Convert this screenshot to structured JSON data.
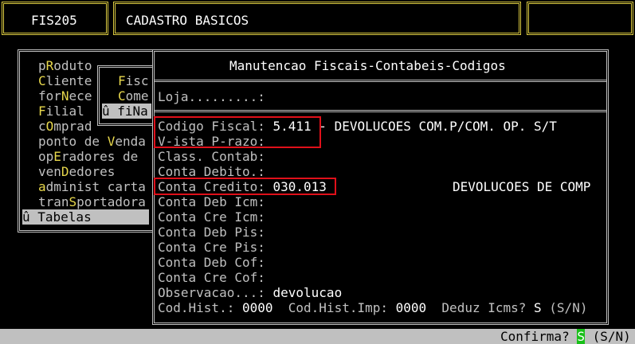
{
  "header": {
    "program_code": "FIS205",
    "module_title": "CADASTRO BASICOS"
  },
  "menu": {
    "items": [
      {
        "pre": "p",
        "hot": "R",
        "post": "oduto"
      },
      {
        "pre": "",
        "hot": "C",
        "post": "liente"
      },
      {
        "pre": "for",
        "hot": "N",
        "post": "ece"
      },
      {
        "pre": "",
        "hot": "F",
        "post": "ilial"
      },
      {
        "pre": "c",
        "hot": "O",
        "post": "mprad"
      },
      {
        "pre": "ponto de ",
        "hot": "V",
        "post": "enda"
      },
      {
        "pre": "op",
        "hot": "E",
        "post": "radores de"
      },
      {
        "pre": "ven",
        "hot": "D",
        "post": "edores"
      },
      {
        "pre": "",
        "hot": "a",
        "post": "dminist carta"
      },
      {
        "pre": "tran",
        "hot": "S",
        "post": "portadora"
      }
    ],
    "selected": "û Tabelas"
  },
  "submenu": {
    "items": [
      {
        "hot": "F",
        "post": "isc"
      },
      {
        "hot": "C",
        "post": "ome"
      }
    ],
    "selected": "û fiNa"
  },
  "form": {
    "title": "Manutencao Fiscais-Contabeis-Codigos",
    "loja_label": "Loja.........:",
    "codigo_fiscal_label": "Codigo Fiscal: ",
    "codigo_fiscal_value": "5.411",
    "codigo_fiscal_desc": " - DEVOLUCOES COM.P/COM. OP. S/T",
    "vista_prazo_label": "V-ista P-razo:",
    "class_contab_label": "Class. Contab:",
    "conta_debito_label": "Conta Debito.:",
    "conta_credito_label": "Conta Credito: ",
    "conta_credito_value": "030.013",
    "conta_credito_desc": "DEVOLUCOES DE COMP",
    "conta_deb_icm": "Conta Deb Icm:",
    "conta_cre_icm": "Conta Cre Icm:",
    "conta_deb_pis": "Conta Deb Pis:",
    "conta_cre_pis": "Conta Cre Pis:",
    "conta_deb_cof": "Conta Deb Cof:",
    "conta_cre_cof": "Conta Cre Cof:",
    "observacao_label": "Observacao...: ",
    "observacao_value": "devolucao",
    "cod_hist_label": "Cod.Hist.: ",
    "cod_hist_value": "0000",
    "cod_hist_imp_label": "  Cod.Hist.Imp: ",
    "cod_hist_imp_value": "0000",
    "deduz_label": "  Deduz Icms? ",
    "deduz_value": "S",
    "deduz_opts": " (S/N)"
  },
  "status": {
    "prompt": "Confirma? ",
    "value": "S",
    "opts": " (S/N)"
  }
}
